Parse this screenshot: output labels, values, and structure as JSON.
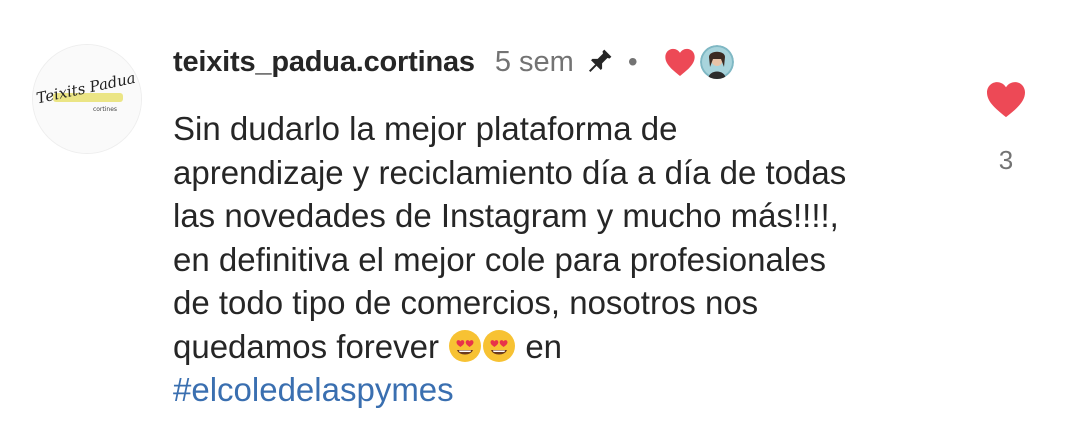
{
  "comment": {
    "author": {
      "username": "teixits_padua.cortinas",
      "avatar_logo_text": "Teixits Padua",
      "avatar_logo_subtext": "cortines"
    },
    "timestamp": "5 sem",
    "pinned": true,
    "separator": "•",
    "liked_by_creator": true,
    "body_lines": [
      "Sin dudarlo la mejor plataforma de",
      "aprendizaje y reciclamiento día a día de todas",
      "las novedades de Instagram y mucho más!!!!,",
      "en definitiva el mejor cole para profesionales",
      "de todo tipo de comercios, nosotros nos"
    ],
    "last_line_prefix": "quedamos forever",
    "emojis": [
      "😍",
      "😍"
    ],
    "last_line_suffix": "en",
    "hashtag": "#elcoledelaspymes",
    "like_count": "3"
  },
  "icons": {
    "pin": "pin-icon",
    "heart_small": "heart-icon",
    "heart_large": "like-heart-icon",
    "emoji": "heart-eyes-emoji"
  },
  "colors": {
    "heart": "#ed4956",
    "hashtag": "#3a6fb0",
    "text": "#262626",
    "muted": "#737373"
  }
}
